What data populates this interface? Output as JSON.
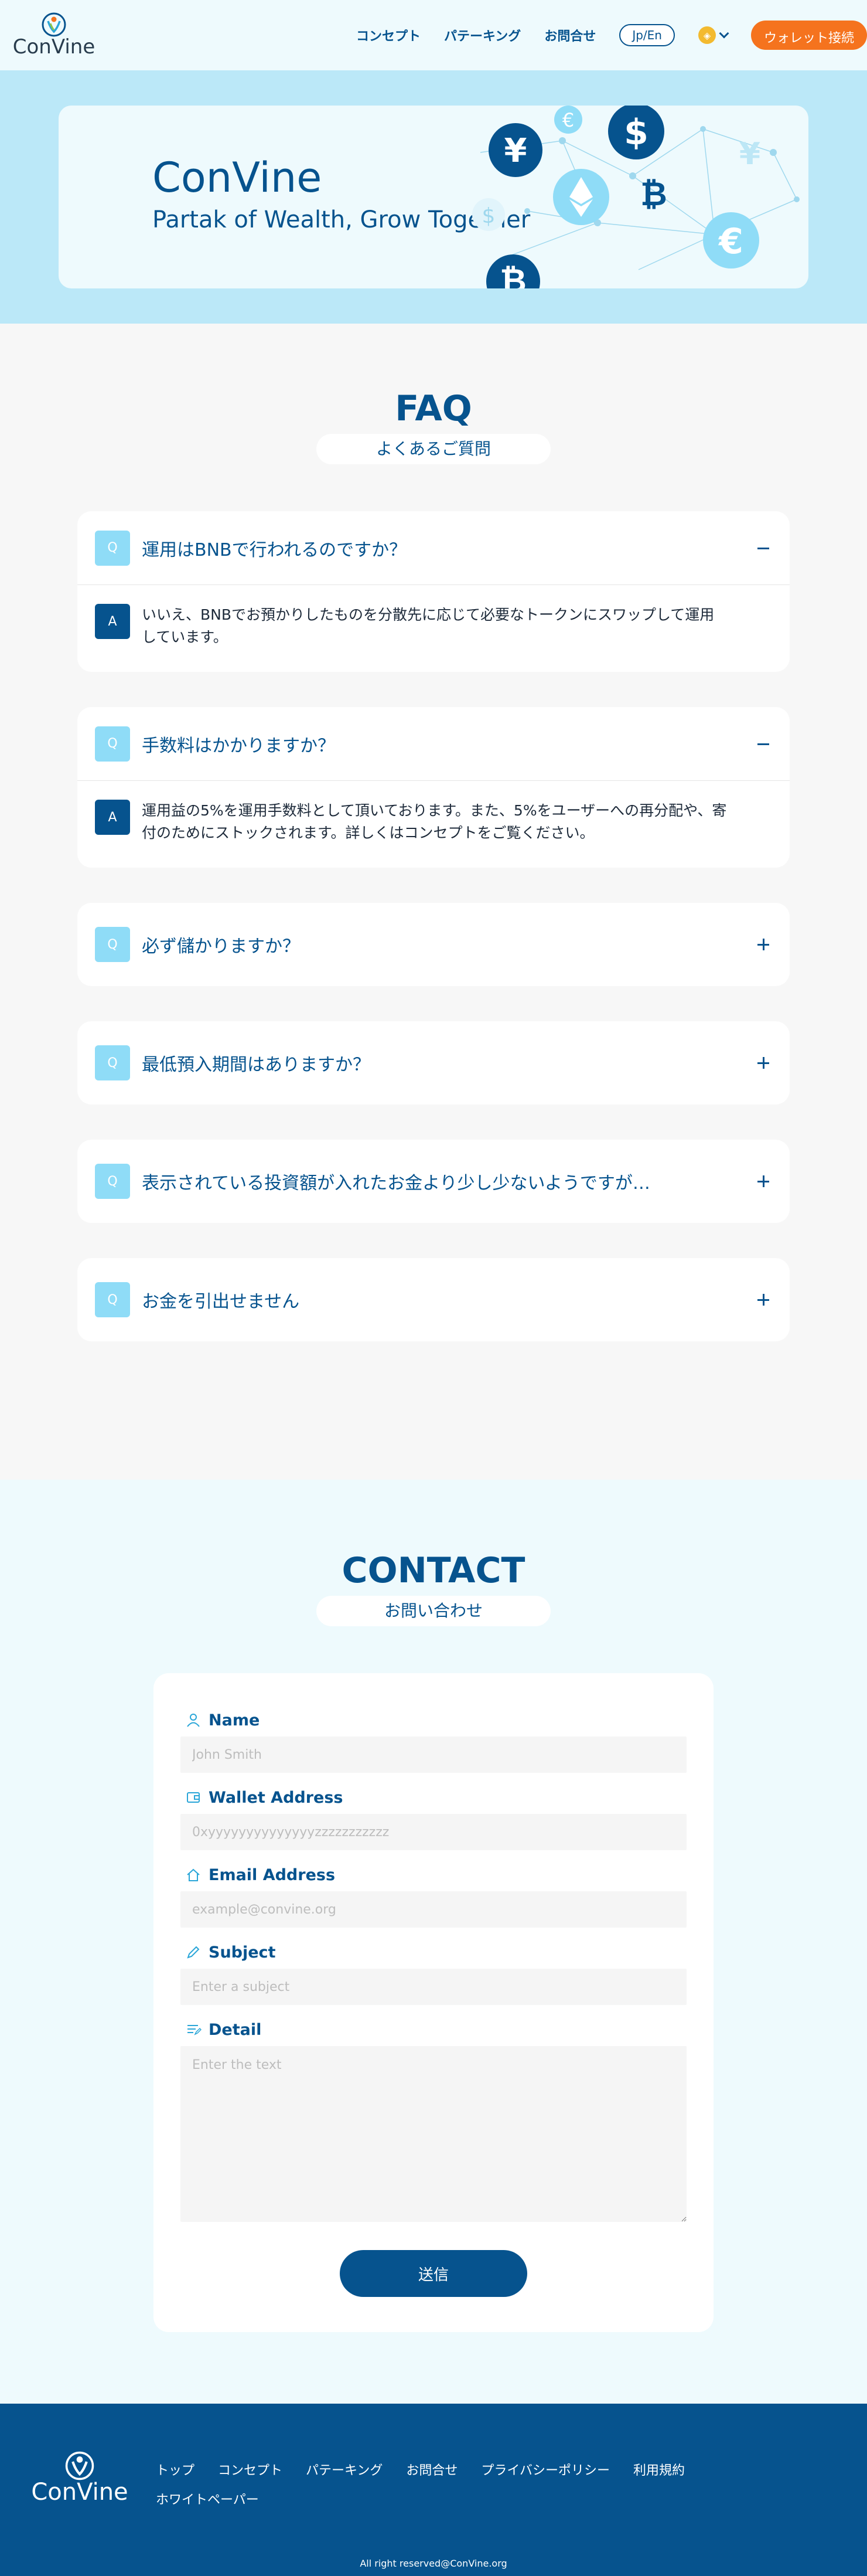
{
  "header": {
    "logo_text": "ConVine",
    "nav": [
      "コンセプト",
      "パテーキング",
      "お問合せ"
    ],
    "lang_label": "Jp/En",
    "wallet_label": "ウォレット接続",
    "currency_icon": "bnb-coin-icon"
  },
  "hero": {
    "title": "ConVine",
    "subtitle": "Partak of Wealth, Grow Together"
  },
  "faq": {
    "title": "FAQ",
    "subtitle": "よくあるご質問",
    "q_badge": "Q",
    "a_badge": "A",
    "items": [
      {
        "q": "運用はBNBで行われるのですか？",
        "a": "いいえ、BNBでお預かりしたものを分散先に応じて必要なトークンにスワップして運用しています。",
        "open": true
      },
      {
        "q": "手数料はかかりますか？",
        "a": "運用益の5%を運用手数料として頂いております。また、5%をユーザーへの再分配や、寄付のためにストックされます。詳しくはコンセプトをご覧ください。",
        "open": true
      },
      {
        "q": "必ず儲かりますか？",
        "open": false
      },
      {
        "q": "最低預入期間はありますか？",
        "open": false
      },
      {
        "q": "表示されている投資額が入れたお金より少し少ないようですが…",
        "open": false
      },
      {
        "q": "お金を引出せません",
        "open": false
      }
    ]
  },
  "contact": {
    "title": "CONTACT",
    "subtitle": "お問い合わせ",
    "fields": {
      "name": {
        "label": "Name",
        "placeholder": "John Smith"
      },
      "wallet": {
        "label": "Wallet Address",
        "placeholder": "0xyyyyyyyyyyyyyyzzzzzzzzzzz"
      },
      "email": {
        "label": "Email Address",
        "placeholder": "example@convine.org"
      },
      "subject": {
        "label": "Subject",
        "placeholder": "Enter a subject"
      },
      "detail": {
        "label": "Detail",
        "placeholder": "Enter the text"
      }
    },
    "submit_label": "送信"
  },
  "footer": {
    "logo_text": "ConVine",
    "nav": [
      "トップ",
      "コンセプト",
      "パテーキング",
      "お問合せ",
      "プライバシーポリシー",
      "利用規約",
      "ホワイトペーパー"
    ],
    "copyright": "All right reserved@ConVine.org"
  },
  "colors": {
    "primary": "#06538e",
    "accent": "#f5731e",
    "hero_band": "#bbe8f8",
    "badge_q": "#8fdcf7"
  }
}
